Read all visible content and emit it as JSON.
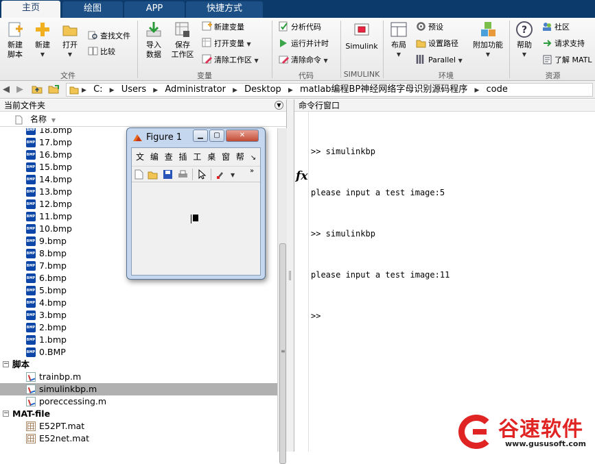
{
  "tabs": [
    {
      "label": "主页"
    },
    {
      "label": "绘图"
    },
    {
      "label": "APP"
    },
    {
      "label": "快捷方式"
    }
  ],
  "ribbon": {
    "file": {
      "group": "文件",
      "new_script": "新建\n脚本",
      "new": "新建",
      "open": "打开",
      "find_files": "查找文件",
      "compare": "比较"
    },
    "variable": {
      "group": "变量",
      "import": "导入\n数据",
      "save_ws": "保存\n工作区",
      "new_var": "新建变量",
      "open_var": "打开变量",
      "clear_ws": "清除工作区"
    },
    "code": {
      "group": "代码",
      "analyze": "分析代码",
      "run_time": "运行并计时",
      "clear_cmd": "清除命令"
    },
    "simulink": {
      "group": "SIMULINK",
      "simulink": "Simulink"
    },
    "env": {
      "group": "环境",
      "layout": "布局",
      "prefs": "预设",
      "set_path": "设置路径",
      "parallel": "Parallel",
      "addons": "附加功能"
    },
    "resources": {
      "group": "资源",
      "help": "帮助",
      "community": "社区",
      "support": "请求支持",
      "learn": "了解 MATL"
    }
  },
  "address": {
    "segments": [
      "C:",
      "Users",
      "Administrator",
      "Desktop",
      "matlab编程BP神经网络字母识别源码程序",
      "code"
    ]
  },
  "left_panel": {
    "title": "当前文件夹",
    "col_name": "名称",
    "bmp_files": [
      "18.bmp",
      "17.bmp",
      "16.bmp",
      "15.bmp",
      "14.bmp",
      "13.bmp",
      "12.bmp",
      "11.bmp",
      "10.bmp",
      "9.bmp",
      "8.bmp",
      "7.bmp",
      "6.bmp",
      "5.bmp",
      "4.bmp",
      "3.bmp",
      "2.bmp",
      "1.bmp",
      "0.BMP"
    ],
    "scripts_header": "脚本",
    "scripts": [
      "trainbp.m",
      "simulinkbp.m",
      "poreccessing.m"
    ],
    "selected_script": "simulinkbp.m",
    "mat_header": "MAT-file",
    "mat_files": [
      "E52PT.mat",
      "E52net.mat"
    ]
  },
  "command_window": {
    "title": "命令行窗口",
    "lines": [
      ">> simulinkbp",
      "please input a test image:5",
      ">> simulinkbp",
      "please input a test image:11",
      ">>"
    ],
    "fx": "fx"
  },
  "figure": {
    "title": "Figure 1",
    "menu": [
      "文",
      "编",
      "查",
      "插",
      "工",
      "桌",
      "窗",
      "帮"
    ]
  },
  "watermark": {
    "name": "谷速软件",
    "url": "www.gususoft.com"
  },
  "colors": {
    "tab_bar": "#0c3a6a",
    "tab_active_text": "#1a3c66",
    "selection": "#b0b0b0",
    "watermark": "#e02424"
  }
}
